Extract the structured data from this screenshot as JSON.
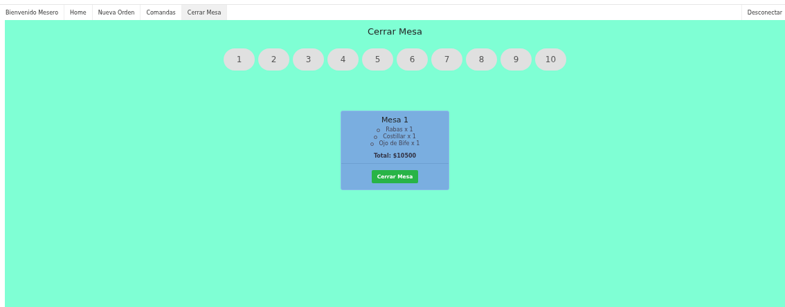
{
  "navbar": {
    "brand": "Bienvenido Mesero",
    "items": [
      {
        "label": "Home",
        "selected": false
      },
      {
        "label": "Nueva Orden",
        "selected": false
      },
      {
        "label": "Comandas",
        "selected": false
      },
      {
        "label": "Cerrar Mesa",
        "selected": true
      }
    ],
    "logout": "Desconectar"
  },
  "page_title": "Cerrar Mesa",
  "tables": [
    "1",
    "2",
    "3",
    "4",
    "5",
    "6",
    "7",
    "8",
    "9",
    "10"
  ],
  "card": {
    "title": "Mesa 1",
    "items": [
      "Rabas x 1",
      "Costillar x 1",
      "Ojo de Bife x 1"
    ],
    "total": "Total: $10500",
    "button": "Cerrar Mesa"
  }
}
